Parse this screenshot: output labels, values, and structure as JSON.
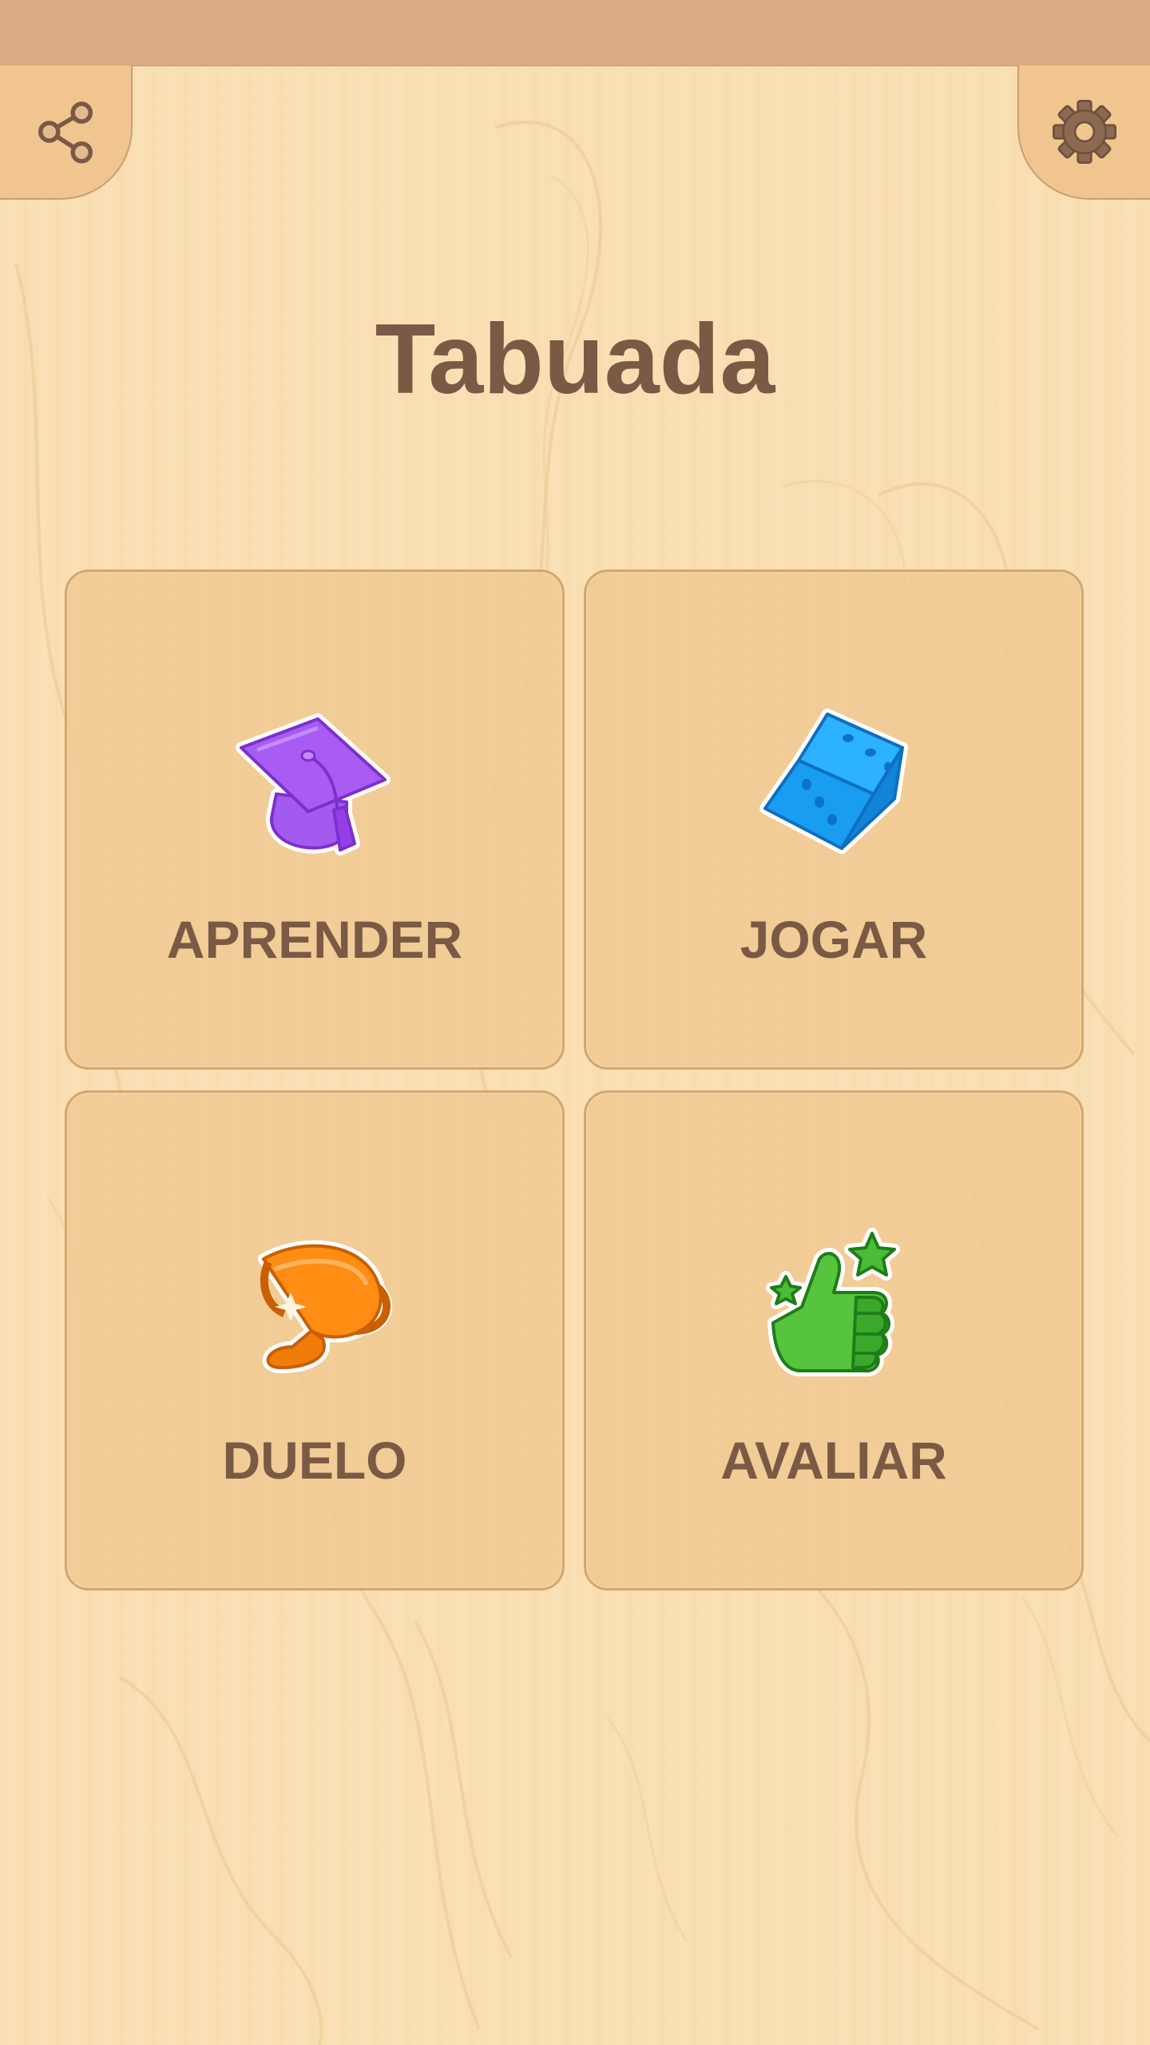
{
  "app": {
    "title": "Tabuada"
  },
  "toolbar": {
    "share_icon": "share-icon",
    "settings_icon": "gear-icon"
  },
  "menu": [
    {
      "label": "APRENDER",
      "icon": "graduation-cap-icon"
    },
    {
      "label": "JOGAR",
      "icon": "dice-icon"
    },
    {
      "label": "DUELO",
      "icon": "trophy-icon"
    },
    {
      "label": "AVALIAR",
      "icon": "thumbs-up-icon"
    }
  ],
  "colors": {
    "background": "#f9dfb4",
    "status_bar": "#dcaa85",
    "card": "#f0c891",
    "card_border": "#d4a66f",
    "text": "#7a5a45",
    "cap_purple": "#9b4fe8",
    "dice_blue": "#1ea4f5",
    "trophy_orange": "#f48a12",
    "thumb_green": "#4cbb35"
  }
}
